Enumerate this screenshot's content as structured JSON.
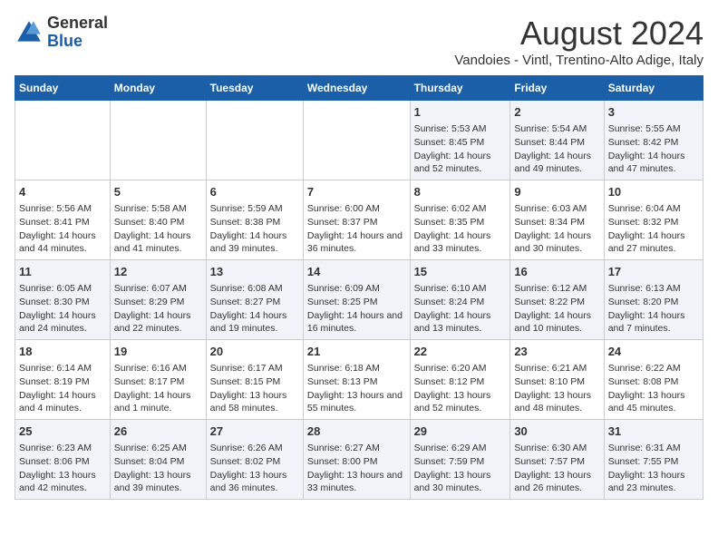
{
  "logo": {
    "general": "General",
    "blue": "Blue"
  },
  "title": "August 2024",
  "subtitle": "Vandoies - Vintl, Trentino-Alto Adige, Italy",
  "days_header": [
    "Sunday",
    "Monday",
    "Tuesday",
    "Wednesday",
    "Thursday",
    "Friday",
    "Saturday"
  ],
  "weeks": [
    [
      {
        "day": "",
        "content": ""
      },
      {
        "day": "",
        "content": ""
      },
      {
        "day": "",
        "content": ""
      },
      {
        "day": "",
        "content": ""
      },
      {
        "day": "1",
        "content": "Sunrise: 5:53 AM\nSunset: 8:45 PM\nDaylight: 14 hours and 52 minutes."
      },
      {
        "day": "2",
        "content": "Sunrise: 5:54 AM\nSunset: 8:44 PM\nDaylight: 14 hours and 49 minutes."
      },
      {
        "day": "3",
        "content": "Sunrise: 5:55 AM\nSunset: 8:42 PM\nDaylight: 14 hours and 47 minutes."
      }
    ],
    [
      {
        "day": "4",
        "content": "Sunrise: 5:56 AM\nSunset: 8:41 PM\nDaylight: 14 hours and 44 minutes."
      },
      {
        "day": "5",
        "content": "Sunrise: 5:58 AM\nSunset: 8:40 PM\nDaylight: 14 hours and 41 minutes."
      },
      {
        "day": "6",
        "content": "Sunrise: 5:59 AM\nSunset: 8:38 PM\nDaylight: 14 hours and 39 minutes."
      },
      {
        "day": "7",
        "content": "Sunrise: 6:00 AM\nSunset: 8:37 PM\nDaylight: 14 hours and 36 minutes."
      },
      {
        "day": "8",
        "content": "Sunrise: 6:02 AM\nSunset: 8:35 PM\nDaylight: 14 hours and 33 minutes."
      },
      {
        "day": "9",
        "content": "Sunrise: 6:03 AM\nSunset: 8:34 PM\nDaylight: 14 hours and 30 minutes."
      },
      {
        "day": "10",
        "content": "Sunrise: 6:04 AM\nSunset: 8:32 PM\nDaylight: 14 hours and 27 minutes."
      }
    ],
    [
      {
        "day": "11",
        "content": "Sunrise: 6:05 AM\nSunset: 8:30 PM\nDaylight: 14 hours and 24 minutes."
      },
      {
        "day": "12",
        "content": "Sunrise: 6:07 AM\nSunset: 8:29 PM\nDaylight: 14 hours and 22 minutes."
      },
      {
        "day": "13",
        "content": "Sunrise: 6:08 AM\nSunset: 8:27 PM\nDaylight: 14 hours and 19 minutes."
      },
      {
        "day": "14",
        "content": "Sunrise: 6:09 AM\nSunset: 8:25 PM\nDaylight: 14 hours and 16 minutes."
      },
      {
        "day": "15",
        "content": "Sunrise: 6:10 AM\nSunset: 8:24 PM\nDaylight: 14 hours and 13 minutes."
      },
      {
        "day": "16",
        "content": "Sunrise: 6:12 AM\nSunset: 8:22 PM\nDaylight: 14 hours and 10 minutes."
      },
      {
        "day": "17",
        "content": "Sunrise: 6:13 AM\nSunset: 8:20 PM\nDaylight: 14 hours and 7 minutes."
      }
    ],
    [
      {
        "day": "18",
        "content": "Sunrise: 6:14 AM\nSunset: 8:19 PM\nDaylight: 14 hours and 4 minutes."
      },
      {
        "day": "19",
        "content": "Sunrise: 6:16 AM\nSunset: 8:17 PM\nDaylight: 14 hours and 1 minute."
      },
      {
        "day": "20",
        "content": "Sunrise: 6:17 AM\nSunset: 8:15 PM\nDaylight: 13 hours and 58 minutes."
      },
      {
        "day": "21",
        "content": "Sunrise: 6:18 AM\nSunset: 8:13 PM\nDaylight: 13 hours and 55 minutes."
      },
      {
        "day": "22",
        "content": "Sunrise: 6:20 AM\nSunset: 8:12 PM\nDaylight: 13 hours and 52 minutes."
      },
      {
        "day": "23",
        "content": "Sunrise: 6:21 AM\nSunset: 8:10 PM\nDaylight: 13 hours and 48 minutes."
      },
      {
        "day": "24",
        "content": "Sunrise: 6:22 AM\nSunset: 8:08 PM\nDaylight: 13 hours and 45 minutes."
      }
    ],
    [
      {
        "day": "25",
        "content": "Sunrise: 6:23 AM\nSunset: 8:06 PM\nDaylight: 13 hours and 42 minutes."
      },
      {
        "day": "26",
        "content": "Sunrise: 6:25 AM\nSunset: 8:04 PM\nDaylight: 13 hours and 39 minutes."
      },
      {
        "day": "27",
        "content": "Sunrise: 6:26 AM\nSunset: 8:02 PM\nDaylight: 13 hours and 36 minutes."
      },
      {
        "day": "28",
        "content": "Sunrise: 6:27 AM\nSunset: 8:00 PM\nDaylight: 13 hours and 33 minutes."
      },
      {
        "day": "29",
        "content": "Sunrise: 6:29 AM\nSunset: 7:59 PM\nDaylight: 13 hours and 30 minutes."
      },
      {
        "day": "30",
        "content": "Sunrise: 6:30 AM\nSunset: 7:57 PM\nDaylight: 13 hours and 26 minutes."
      },
      {
        "day": "31",
        "content": "Sunrise: 6:31 AM\nSunset: 7:55 PM\nDaylight: 13 hours and 23 minutes."
      }
    ]
  ]
}
